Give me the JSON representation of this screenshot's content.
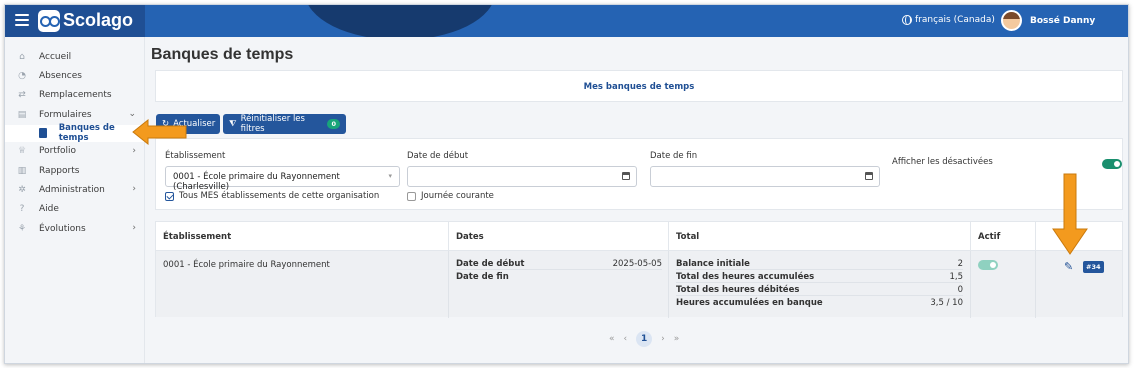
{
  "topbar": {
    "brand": "Scolago",
    "language": "français (Canada)",
    "user_name": "Bossé Danny"
  },
  "sidebar": {
    "items": [
      {
        "label": "Accueil",
        "icon": "home-icon"
      },
      {
        "label": "Absences",
        "icon": "users-icon"
      },
      {
        "label": "Remplacements",
        "icon": "swap-icon"
      },
      {
        "label": "Formulaires",
        "icon": "document-icon",
        "expanded": true
      },
      {
        "label": "Portfolio",
        "icon": "trophy-icon"
      },
      {
        "label": "Rapports",
        "icon": "report-icon"
      },
      {
        "label": "Administration",
        "icon": "gear-icon"
      },
      {
        "label": "Aide",
        "icon": "question-icon"
      },
      {
        "label": "Évolutions",
        "icon": "sprout-icon"
      }
    ],
    "sub_item": "Banques de temps"
  },
  "page": {
    "title": "Banques de temps",
    "tab": "Mes banques de temps"
  },
  "toolbar": {
    "refresh_label": "Actualiser",
    "reset_label": "Réinitialiser les filtres",
    "reset_count": "0"
  },
  "filters": {
    "establishment_label": "Établissement",
    "establishment_value": "0001 - École primaire du Rayonnement (Charlesville)",
    "all_establishments_label": "Tous MES établissements de cette organisation",
    "all_establishments_checked": true,
    "start_date_label": "Date de début",
    "start_date_value": "",
    "current_day_label": "Journée courante",
    "current_day_checked": false,
    "end_date_label": "Date de fin",
    "end_date_value": "",
    "show_disabled_label": "Afficher les désactivées",
    "show_disabled_on": true
  },
  "table": {
    "headers": [
      "Établissement",
      "Dates",
      "Total",
      "Actif",
      ""
    ],
    "rows": [
      {
        "establishment": "0001 - École primaire du Rayonnement",
        "dates": {
          "start_label": "Date de début",
          "start_value": "2025-05-05",
          "end_label": "Date de fin",
          "end_value": ""
        },
        "totals": [
          {
            "label": "Balance initiale",
            "value": "2"
          },
          {
            "label": "Total des heures accumulées",
            "value": "1,5"
          },
          {
            "label": "Total des heures débitées",
            "value": "0"
          },
          {
            "label": "Heures accumulées en banque",
            "value": "3,5 / 10"
          }
        ],
        "active": true,
        "id_badge": "#34"
      }
    ]
  },
  "pager": {
    "first": "«",
    "prev": "‹",
    "current": "1",
    "next": "›",
    "last": "»"
  },
  "colors": {
    "primary": "#24569c",
    "accent_green": "#1a8f6e",
    "arrow_orange": "#f39a1e"
  }
}
